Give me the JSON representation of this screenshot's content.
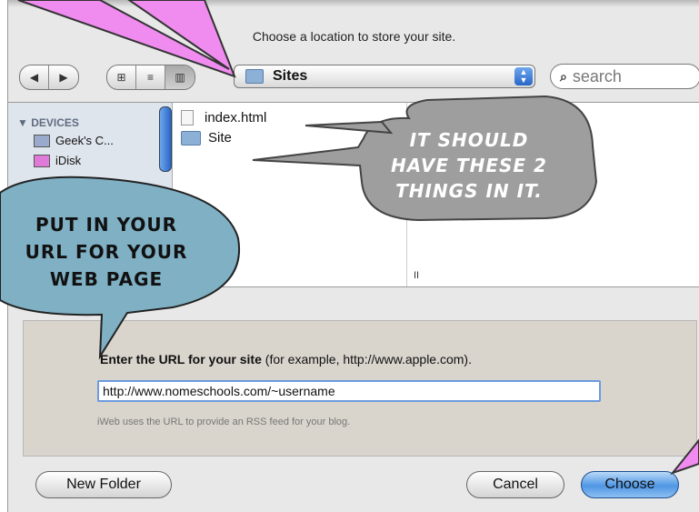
{
  "dialog": {
    "prompt": "Choose a location to store your site.",
    "location_popup": "Sites",
    "search_placeholder": "search"
  },
  "toolbar": {
    "back_icon": "back-arrow-icon",
    "forward_icon": "forward-arrow-icon",
    "view_modes": [
      "icon-view",
      "list-view",
      "column-view"
    ]
  },
  "sidebar": {
    "heading": "▼ DEVICES",
    "items": [
      {
        "label": "Geek's C...",
        "icon": "computer-icon"
      },
      {
        "label": "iDisk",
        "icon": "idisk-icon"
      }
    ]
  },
  "files": [
    {
      "name": "index.html",
      "icon": "document-icon"
    },
    {
      "name": "Site",
      "icon": "folder-icon"
    }
  ],
  "url_section": {
    "label_lead": "Enter the URL for your site",
    "label_rest": " (for example, http://www.apple.com).",
    "value": "http://www.nomeschools.com/~username",
    "hint": "iWeb uses the URL to provide an RSS feed for your blog."
  },
  "buttons": {
    "new_folder": "New Folder",
    "cancel": "Cancel",
    "choose": "Choose"
  },
  "annotations": {
    "right_bubble": [
      "IT SHOULD",
      "HAVE THESE 2",
      "THINGS IN IT."
    ],
    "left_bubble": [
      "PUT IN YOUR",
      "URL FOR YOUR",
      "WEB PAGE"
    ]
  },
  "colors": {
    "accent": "#2866c8",
    "pink_arrow": "#f08cf0",
    "callout_gray": "#9e9e9e",
    "callout_blue": "#7fb0c4"
  }
}
